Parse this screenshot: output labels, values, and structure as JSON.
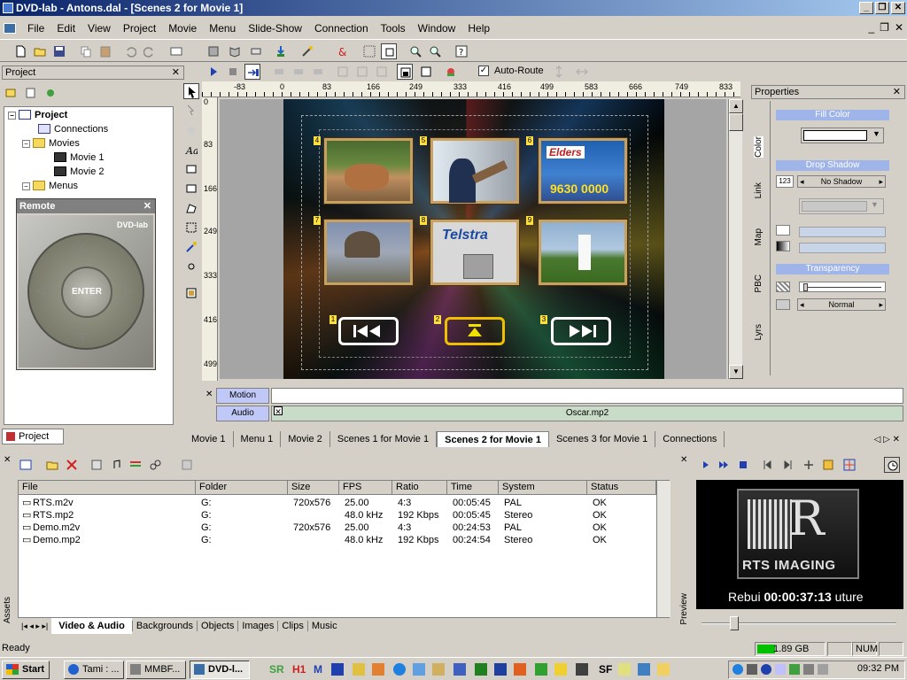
{
  "window": {
    "title": "DVD-lab - Antons.dal - [Scenes 2 for Movie 1]"
  },
  "menubar": [
    "File",
    "Edit",
    "View",
    "Project",
    "Movie",
    "Menu",
    "Slide-Show",
    "Connection",
    "Tools",
    "Window",
    "Help"
  ],
  "route_toolbar": {
    "auto_route_label": "Auto-Route",
    "auto_route_checked": true
  },
  "project_panel": {
    "header": "Project",
    "tree": {
      "project": "Project",
      "connections": "Connections",
      "movies": "Movies",
      "movie1": "Movie 1",
      "movie2": "Movie 2",
      "menus": "Menus"
    },
    "tab": "Project"
  },
  "remote": {
    "title": "Remote",
    "brand": "DVD-lab",
    "enter_label": "ENTER"
  },
  "ruler": {
    "h_ticks": [
      "-83",
      "0",
      "83",
      "166",
      "249",
      "333",
      "416",
      "499",
      "583",
      "666",
      "749",
      "833"
    ],
    "v_ticks": [
      "0",
      "83",
      "166",
      "249",
      "333",
      "416",
      "499"
    ]
  },
  "menu_preview": {
    "thumbs": [
      {
        "num": "4",
        "desc": "dog"
      },
      {
        "num": "5",
        "desc": "worker"
      },
      {
        "num": "6",
        "desc": "elders",
        "logo": "Elders",
        "phone": "9630 0000"
      },
      {
        "num": "7",
        "desc": "excavator"
      },
      {
        "num": "8",
        "desc": "telstra",
        "logo": "Telstra"
      },
      {
        "num": "9",
        "desc": "taichi"
      }
    ],
    "nav_nums": [
      "1",
      "2",
      "3"
    ]
  },
  "timeline": {
    "motion_label": "Motion",
    "audio_label": "Audio",
    "audio_file": "Oscar.mp2"
  },
  "doc_tabs": [
    "Movie 1",
    "Menu 1",
    "Movie 2",
    "Scenes 1 for Movie 1",
    "Scenes 2 for Movie 1",
    "Scenes 3 for Movie 1",
    "Connections"
  ],
  "active_doc_tab": "Scenes 2 for Movie 1",
  "properties": {
    "header": "Properties",
    "fill_color": "Fill Color",
    "drop_shadow": "Drop Shadow",
    "shadow_value": "123",
    "shadow_mode": "No Shadow",
    "transparency": "Transparency",
    "blend_mode": "Normal",
    "side_tabs": [
      "Color",
      "Link",
      "Map",
      "PBC",
      "Lyrs"
    ],
    "fill_swatch": "#ffffff"
  },
  "assets": {
    "side_label": "Assets",
    "columns": [
      "File",
      "Folder",
      "Size",
      "FPS",
      "Ratio",
      "Time",
      "System",
      "Status"
    ],
    "rows": [
      [
        "RTS.m2v",
        "G:",
        "720x576",
        "25.00",
        "4:3",
        "00:05:45",
        "PAL",
        "OK"
      ],
      [
        "RTS.mp2",
        "G:",
        "",
        "48.0 kHz",
        "192 Kbps",
        "00:05:45",
        "Stereo",
        "OK"
      ],
      [
        "Demo.m2v",
        "G:",
        "720x576",
        "25.00",
        "4:3",
        "00:24:53",
        "PAL",
        "OK"
      ],
      [
        "Demo.mp2",
        "G:",
        "",
        "48.0 kHz",
        "192 Kbps",
        "00:24:54",
        "Stereo",
        "OK"
      ]
    ],
    "tabs": [
      "Video & Audio",
      "Backgrounds",
      "Objects",
      "Images",
      "Clips",
      "Music"
    ],
    "active_tab": "Video & Audio"
  },
  "preview": {
    "side_label": "Preview",
    "logo_text": "RTS IMAGING",
    "caption_left": "Rebui",
    "timecode": "00:00:37:13",
    "caption_right": "uture",
    "slider_level": 0.15
  },
  "statusbar": {
    "text": "Ready",
    "disk": "1.89 GB",
    "num": "NUM"
  },
  "taskbar": {
    "start": "Start",
    "buttons": [
      "Tami : ...",
      "MMBF...",
      "DVD-l..."
    ],
    "active": "DVD-l...",
    "quick": [
      "SR",
      "H1",
      "M",
      "SF"
    ],
    "clock": "09:32 PM"
  }
}
